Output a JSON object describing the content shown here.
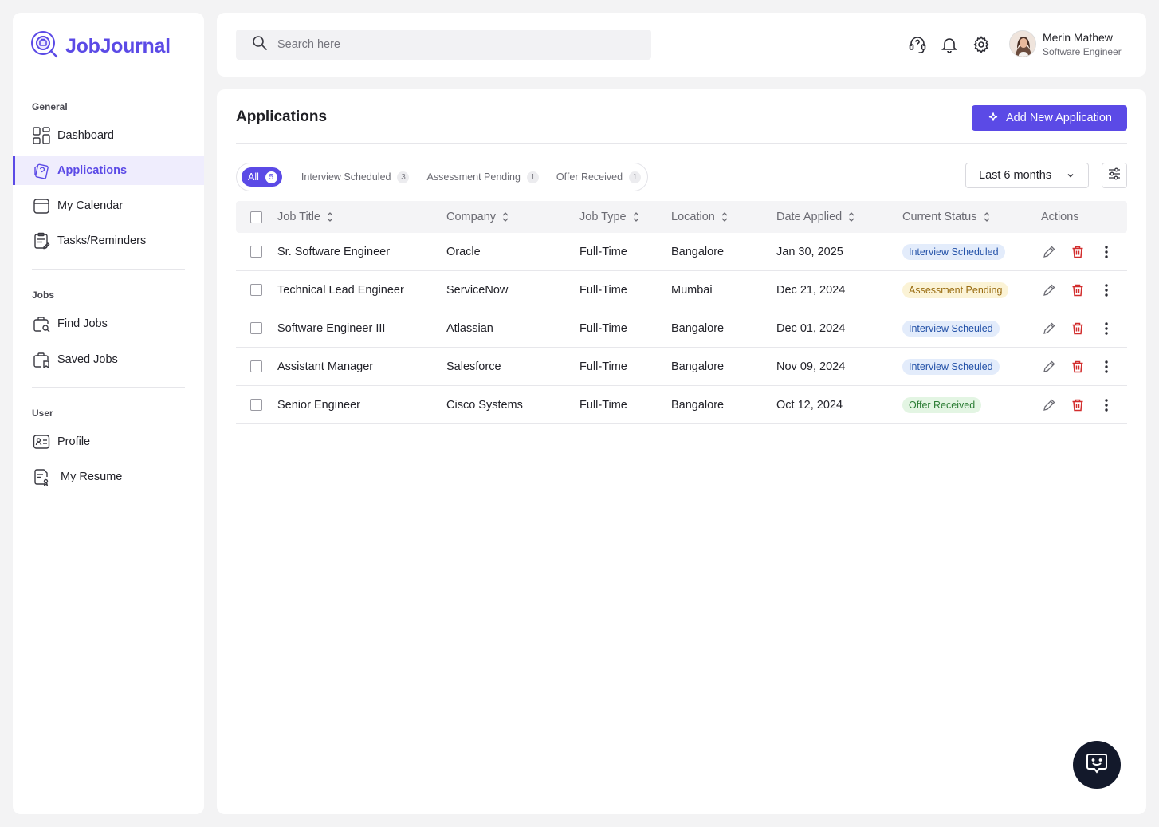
{
  "brand": {
    "name": "JobJournal",
    "accent": "#5b4ae6"
  },
  "sidebar": {
    "sections": [
      {
        "label": "General"
      },
      {
        "label": "Jobs"
      },
      {
        "label": "User"
      }
    ],
    "items": [
      {
        "label": "Dashboard",
        "icon": "grid-icon"
      },
      {
        "label": "Applications",
        "icon": "applications-icon",
        "active": true
      },
      {
        "label": "My Calendar",
        "icon": "calendar-icon"
      },
      {
        "label": "Tasks/Reminders",
        "icon": "tasks-icon"
      },
      {
        "label": "Find Jobs",
        "icon": "find-jobs-icon"
      },
      {
        "label": "Saved Jobs",
        "icon": "saved-jobs-icon"
      },
      {
        "label": "Profile",
        "icon": "profile-icon"
      },
      {
        "label": "My Resume",
        "icon": "resume-icon"
      }
    ]
  },
  "topbar": {
    "search_placeholder": "Search here",
    "user": {
      "name": "Merin Mathew",
      "role": "Software Engineer"
    }
  },
  "main": {
    "title": "Applications",
    "add_button": "Add New Application",
    "filters": [
      {
        "label": "All",
        "count": "5",
        "active": true
      },
      {
        "label": "Interview Scheduled",
        "count": "3"
      },
      {
        "label": "Assessment Pending",
        "count": "1"
      },
      {
        "label": "Offer Received",
        "count": "1"
      }
    ],
    "range": "Last 6 months",
    "columns": [
      "Job Title",
      "Company",
      "Job Type",
      "Location",
      "Date Applied",
      "Current Status",
      "Actions"
    ],
    "rows": [
      {
        "title": "Sr. Software Engineer",
        "company": "Oracle",
        "type": "Full-Time",
        "location": "Bangalore",
        "date": "Jan 30, 2025",
        "status": "Interview Scheduled",
        "status_kind": "blue"
      },
      {
        "title": "Technical Lead Engineer",
        "company": "ServiceNow",
        "type": "Full-Time",
        "location": "Mumbai",
        "date": "Dec 21, 2024",
        "status": "Assessment Pending",
        "status_kind": "yellow"
      },
      {
        "title": "Software Engineer III",
        "company": "Atlassian",
        "type": "Full-Time",
        "location": "Bangalore",
        "date": "Dec 01, 2024",
        "status": "Interview Scheuled",
        "status_kind": "blue"
      },
      {
        "title": "Assistant Manager",
        "company": "Salesforce",
        "type": "Full-Time",
        "location": "Bangalore",
        "date": "Nov 09, 2024",
        "status": "Interview Scheuled",
        "status_kind": "blue"
      },
      {
        "title": "Senior Engineer",
        "company": "Cisco Systems",
        "type": "Full-Time",
        "location": "Bangalore",
        "date": "Oct 12, 2024",
        "status": "Offer Received",
        "status_kind": "green"
      }
    ]
  },
  "status_colors": {
    "blue": {
      "bg": "#e3ecfb",
      "fg": "#2452a8"
    },
    "yellow": {
      "bg": "#fbf3d6",
      "fg": "#9a6d12"
    },
    "green": {
      "bg": "#e3f5e3",
      "fg": "#2c7d35"
    }
  }
}
